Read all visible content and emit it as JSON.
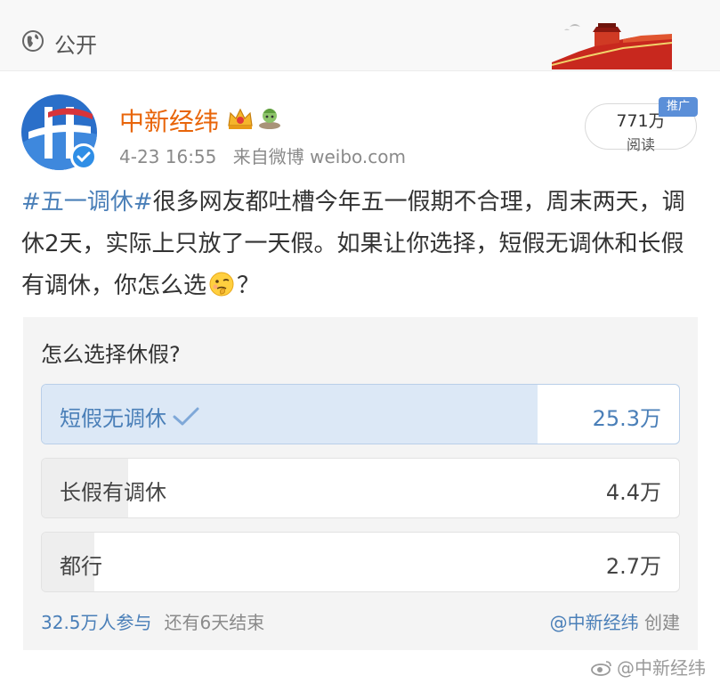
{
  "visibility": {
    "label": "公开"
  },
  "post": {
    "author": "中新经纬",
    "time": "4-23 16:55",
    "source": "来自微博 weibo.com",
    "reads": {
      "count": "771万",
      "label": "阅读",
      "tag": "推广"
    },
    "text": {
      "topic": "#五一调休#",
      "body": "很多网友都吐槽今年五一假期不合理，周末两天，调休2天，实际上只放了一天假。如果让你选择，短假无调休和长假有调休，你怎么选",
      "end": "？"
    }
  },
  "poll": {
    "title": "怎么选择休假?",
    "options": [
      {
        "label": "短假无调休",
        "count": "25.3万",
        "fraction": 0.778,
        "selected": true
      },
      {
        "label": "长假有调休",
        "count": "4.4万",
        "fraction": 0.135,
        "selected": false
      },
      {
        "label": "都行",
        "count": "2.7万",
        "fraction": 0.083,
        "selected": false
      }
    ],
    "participants": "32.5万人参与",
    "ends": "还有6天结束",
    "creator": "@中新经纬",
    "created": "创建"
  },
  "watermark": "@中新经纬",
  "colors": {
    "link": "#4a7fb8",
    "author": "#e8650a",
    "selected_fill": "#dce8f6"
  },
  "icons": [
    "globe-icon",
    "great-wall-image",
    "verified-icon",
    "crown-badge-icon",
    "green-badge-icon",
    "thinking-emoji-icon",
    "check-icon",
    "weibo-eye-icon"
  ]
}
